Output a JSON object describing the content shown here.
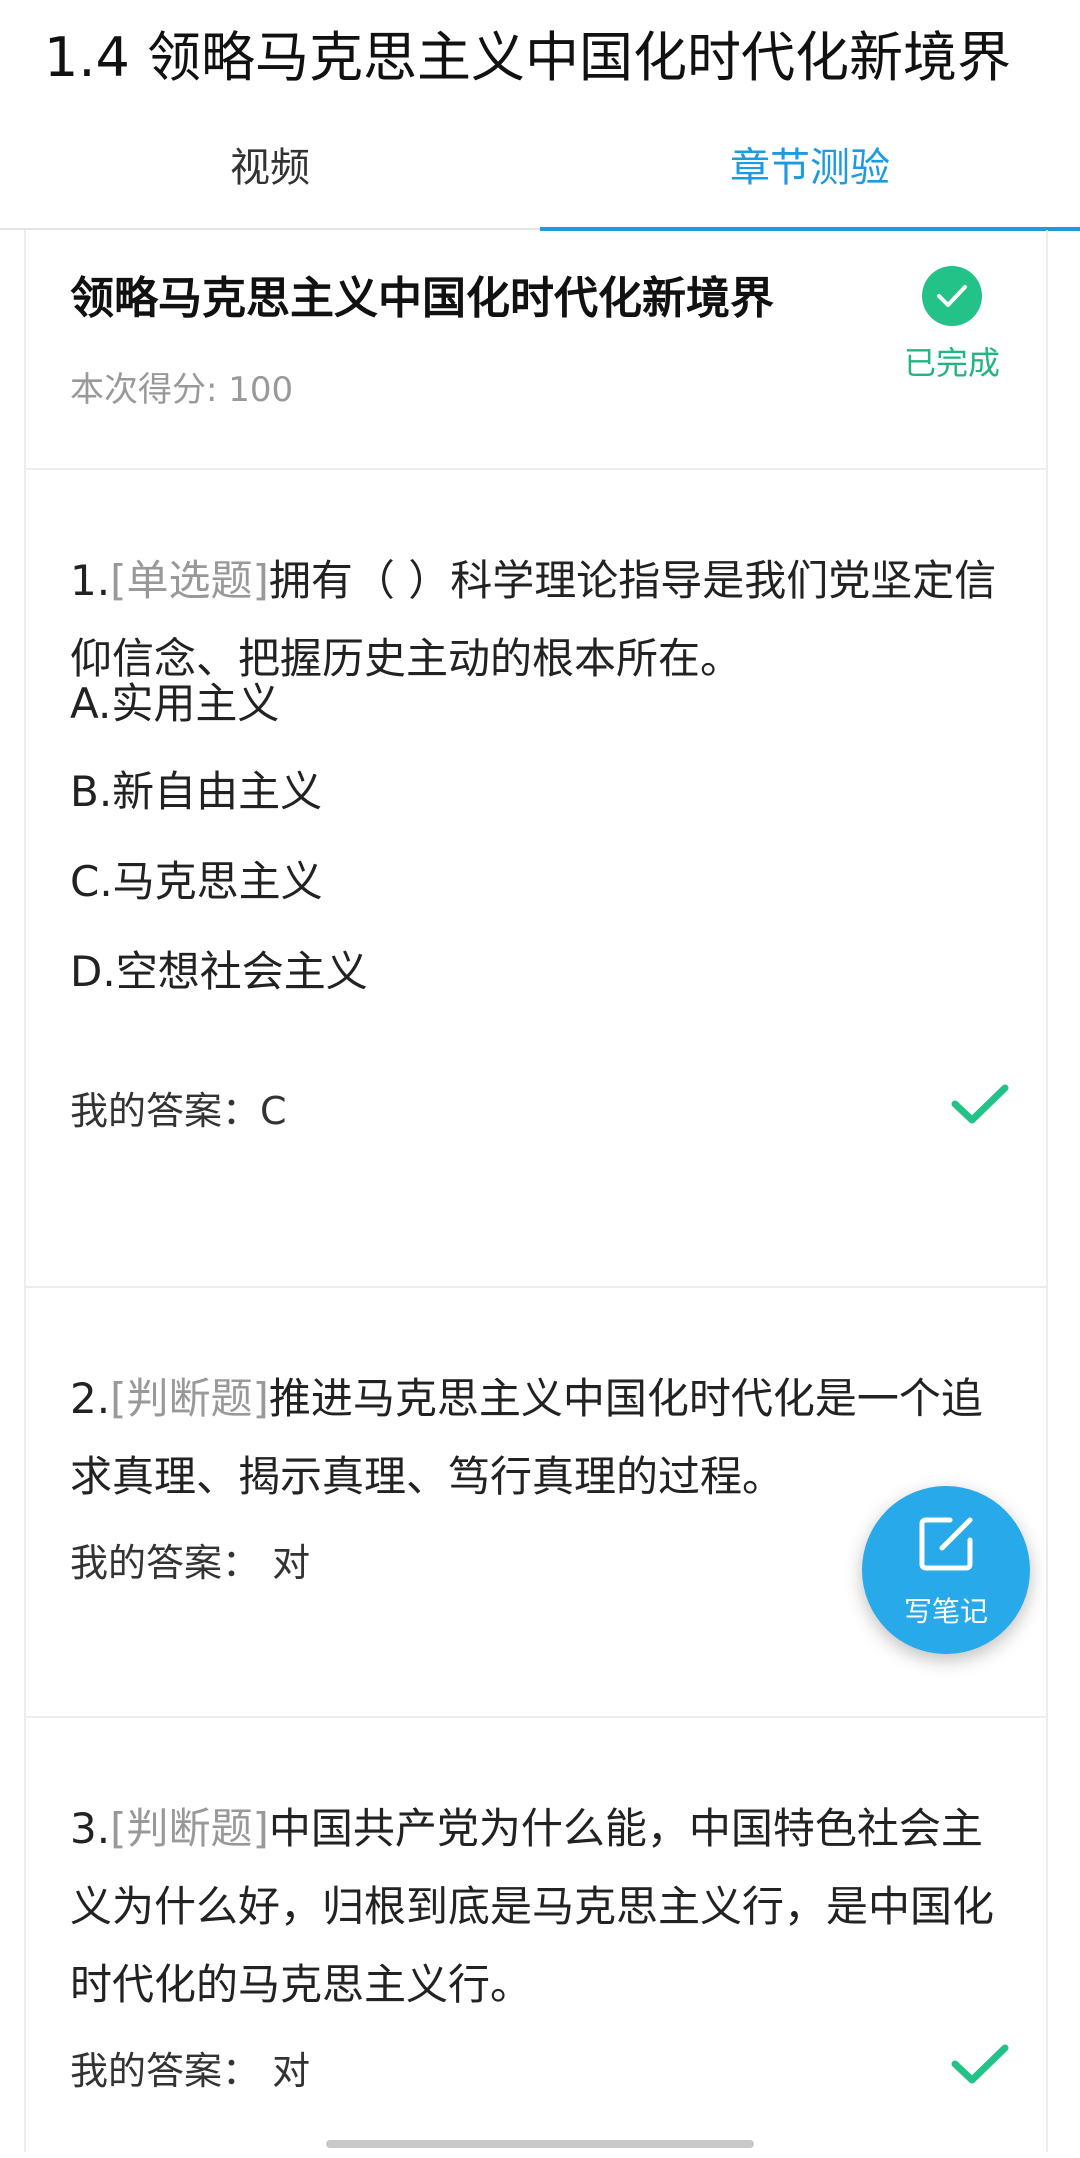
{
  "page": {
    "title": "1.4 领略马克思主义中国化时代化新境界"
  },
  "tabs": [
    {
      "label": "视频",
      "active": false
    },
    {
      "label": "章节测验",
      "active": true
    }
  ],
  "quiz": {
    "title": "领略马克思主义中国化时代化新境界",
    "score_label": "本次得分: 100",
    "status": "已完成"
  },
  "questions": [
    {
      "number": "1.",
      "type": "[单选题]",
      "text": "拥有（ ）科学理论指导是我们党坚定信仰信念、把握历史主动的根本所在。",
      "options": [
        "A.实用主义",
        "B.新自由主义",
        "C.马克思主义",
        "D.空想社会主义"
      ],
      "answer": "我的答案：C",
      "correct": true
    },
    {
      "number": "2.",
      "type": "[判断题]",
      "text": "推进马克思主义中国化时代化是一个追求真理、揭示真理、笃行真理的过程。",
      "answer": "我的答案： 对"
    },
    {
      "number": "3.",
      "type": "[判断题]",
      "text": "中国共产党为什么能，中国特色社会主义为什么好，归根到底是马克思主义行，是中国化时代化的马克思主义行。",
      "answer": "我的答案： 对",
      "correct": true
    }
  ],
  "fab": {
    "label": "写笔记",
    "icon": "edit-note-icon"
  },
  "colors": {
    "accent": "#1e9be0",
    "success": "#22c289",
    "muted": "#999999",
    "fab": "#27a9ea"
  }
}
